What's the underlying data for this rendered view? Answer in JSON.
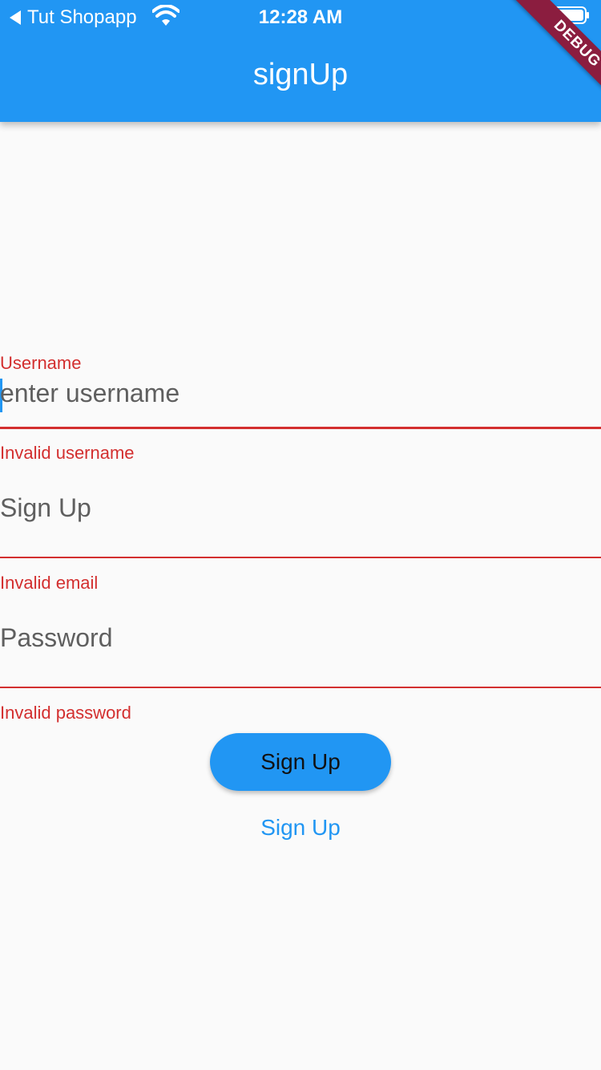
{
  "status_bar": {
    "back_app": "Tut Shopapp",
    "time": "12:28 AM"
  },
  "app_bar": {
    "title": "signUp"
  },
  "debug_banner": {
    "label": "DEBUG"
  },
  "form": {
    "username": {
      "label": "Username",
      "placeholder": "enter username",
      "error": "Invalid username"
    },
    "email": {
      "placeholder": "Sign Up",
      "error": "Invalid email"
    },
    "password": {
      "placeholder": "Password",
      "error": "Invalid password"
    }
  },
  "actions": {
    "signup_button": "Sign Up",
    "signup_link": "Sign Up"
  },
  "colors": {
    "primary": "#2196f3",
    "error": "#d32f2f",
    "background": "#fafafa",
    "debug": "#8b1d3f"
  },
  "icons": {
    "back": "back-triangle-icon",
    "wifi": "wifi-icon",
    "battery": "battery-icon"
  }
}
